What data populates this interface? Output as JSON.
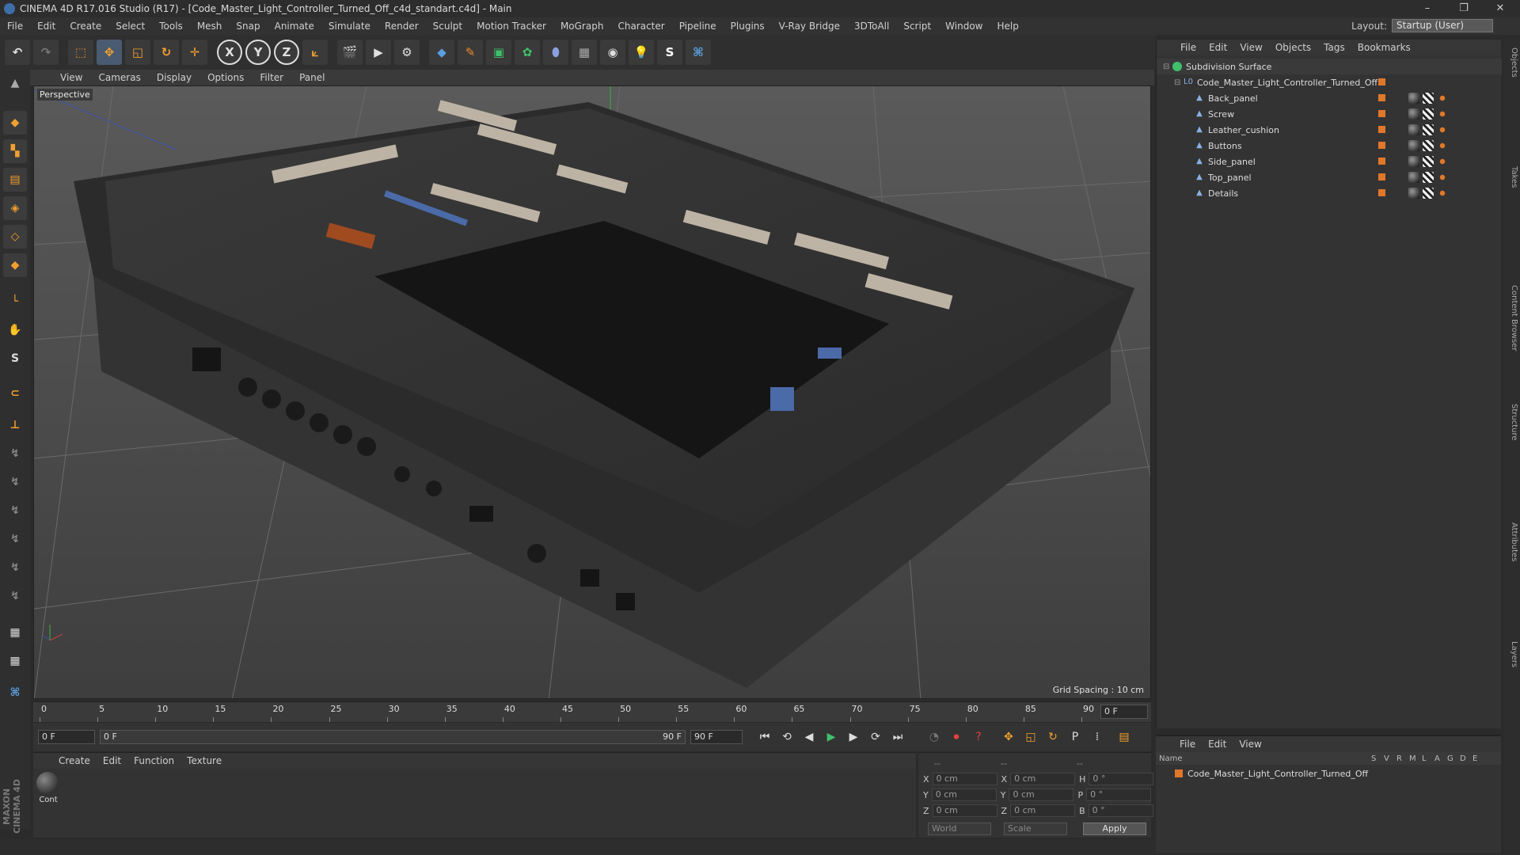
{
  "window": {
    "title": "CINEMA 4D R17.016 Studio (R17) - [Code_Master_Light_Controller_Turned_Off_c4d_standart.c4d] - Main"
  },
  "menu": [
    "File",
    "Edit",
    "Create",
    "Select",
    "Tools",
    "Mesh",
    "Snap",
    "Animate",
    "Simulate",
    "Render",
    "Sculpt",
    "Motion Tracker",
    "MoGraph",
    "Character",
    "Pipeline",
    "Plugins",
    "V-Ray Bridge",
    "3DToAll",
    "Script",
    "Window",
    "Help"
  ],
  "layout": {
    "label": "Layout:",
    "value": "Startup (User)"
  },
  "toolbar": {
    "axes": [
      "X",
      "Y",
      "Z"
    ]
  },
  "viewport": {
    "menu": [
      "View",
      "Cameras",
      "Display",
      "Options",
      "Filter",
      "Panel"
    ],
    "label": "Perspective",
    "grid_spacing": "Grid Spacing : 10 cm"
  },
  "timeline": {
    "marks": [
      "0",
      "5",
      "10",
      "15",
      "20",
      "25",
      "30",
      "35",
      "40",
      "45",
      "50",
      "55",
      "60",
      "65",
      "70",
      "75",
      "80",
      "85",
      "90"
    ],
    "current_frame": "0 F"
  },
  "transport": {
    "start": "0 F",
    "range_start": "0 F",
    "range_end": "90 F",
    "end": "90 F"
  },
  "materials": {
    "menu": [
      "Create",
      "Edit",
      "Function",
      "Texture"
    ],
    "item_label": "Cont"
  },
  "coords": {
    "headers": [
      "--",
      "--",
      "--"
    ],
    "rows": [
      {
        "a": "X",
        "av": "0 cm",
        "b": "X",
        "bv": "0 cm",
        "c": "H",
        "cv": "0 °"
      },
      {
        "a": "Y",
        "av": "0 cm",
        "b": "Y",
        "bv": "0 cm",
        "c": "P",
        "cv": "0 °"
      },
      {
        "a": "Z",
        "av": "0 cm",
        "b": "Z",
        "bv": "0 cm",
        "c": "B",
        "cv": "0 °"
      }
    ],
    "mode1": "World",
    "mode2": "Scale",
    "apply": "Apply"
  },
  "objects": {
    "menu": [
      "File",
      "Edit",
      "View",
      "Objects",
      "Tags",
      "Bookmarks"
    ],
    "items": [
      {
        "name": "Subdivision Surface",
        "level": 0
      },
      {
        "name": "Code_Master_Light_Controller_Turned_Off",
        "level": 1
      },
      {
        "name": "Back_panel",
        "level": 2
      },
      {
        "name": "Screw",
        "level": 2
      },
      {
        "name": "Leather_cushion",
        "level": 2
      },
      {
        "name": "Buttons",
        "level": 2
      },
      {
        "name": "Side_panel",
        "level": 2
      },
      {
        "name": "Top_panel",
        "level": 2
      },
      {
        "name": "Details",
        "level": 2
      }
    ]
  },
  "attributes": {
    "menu": [
      "File",
      "Edit",
      "View"
    ],
    "columns": [
      "Name",
      "S",
      "V",
      "R",
      "M",
      "L",
      "A",
      "G",
      "D",
      "E"
    ],
    "row": "Code_Master_Light_Controller_Turned_Off"
  },
  "sidetabs": [
    "Objects",
    "Takes",
    "Content Browser",
    "Structure",
    "Attributes",
    "Layers"
  ],
  "brand": "MAXON CINEMA 4D",
  "colors": {
    "accent": "#e0782a",
    "selection": "#3d6ea8"
  }
}
